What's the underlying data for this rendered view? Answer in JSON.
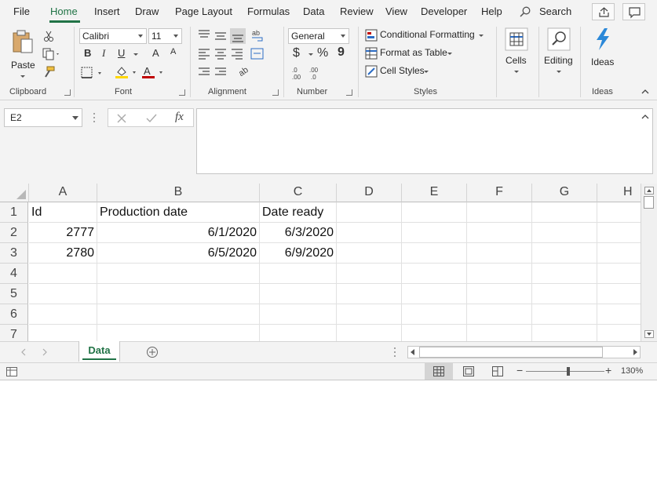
{
  "menu": {
    "tabs": [
      "File",
      "Home",
      "Insert",
      "Draw",
      "Page Layout",
      "Formulas",
      "Data",
      "Review",
      "View",
      "Developer",
      "Help"
    ],
    "search_label": "Search"
  },
  "ribbon": {
    "clipboard": {
      "paste_label": "Paste",
      "group_label": "Clipboard"
    },
    "font": {
      "name": "Calibri",
      "size": "11",
      "group_label": "Font",
      "bold": "B",
      "italic": "I",
      "underline": "U",
      "grow": "A",
      "shrink": "A",
      "font_color": "A"
    },
    "alignment": {
      "group_label": "Alignment"
    },
    "number": {
      "format": "General",
      "currency": "$",
      "percent": "%",
      "comma": "9",
      "group_label": "Number"
    },
    "styles": {
      "conditional_formatting": "Conditional Formatting",
      "format_as_table": "Format as Table",
      "cell_styles": "Cell Styles",
      "group_label": "Styles"
    },
    "cells_label": "Cells",
    "editing_label": "Editing",
    "ideas": {
      "button_label": "Ideas",
      "group_label": "Ideas"
    }
  },
  "formula_bar": {
    "name_box": "E2",
    "fx": "fx",
    "formula": ""
  },
  "grid": {
    "columns": [
      "A",
      "B",
      "C",
      "D",
      "E",
      "F",
      "G",
      "H"
    ],
    "rows": [
      "1",
      "2",
      "3",
      "4",
      "5",
      "6",
      "7"
    ],
    "cells": {
      "A1": "Id",
      "B1": "Production date",
      "C1": "Date ready",
      "A2": "2777",
      "B2": "6/1/2020",
      "C2": "6/3/2020",
      "A3": "2780",
      "B3": "6/5/2020",
      "C3": "6/9/2020"
    }
  },
  "sheet_tabs": {
    "active": "Data"
  },
  "status": {
    "zoom": "130%"
  },
  "colors": {
    "accent": "#217346",
    "ribbon_bg": "#f3f3f3",
    "grid_line": "#e1e1e1"
  }
}
